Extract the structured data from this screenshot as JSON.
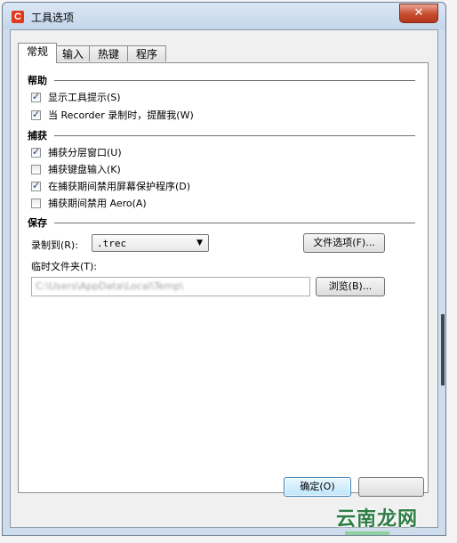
{
  "window": {
    "title": "工具选项",
    "app_icon": "C",
    "close_glyph": "✕"
  },
  "tabs": [
    {
      "label": "常规",
      "active": true
    },
    {
      "label": "输入",
      "active": false
    },
    {
      "label": "热键",
      "active": false
    },
    {
      "label": "程序",
      "active": false
    }
  ],
  "help_group": {
    "title": "帮助",
    "items": [
      {
        "label": "显示工具提示(S)",
        "checked": true
      },
      {
        "label": "当 Recorder 录制时，提醒我(W)",
        "checked": true
      }
    ]
  },
  "capture_group": {
    "title": "捕获",
    "items": [
      {
        "label": "捕获分层窗口(U)",
        "checked": true
      },
      {
        "label": "捕获键盘输入(K)",
        "checked": false
      },
      {
        "label": "在捕获期间禁用屏幕保护程序(D)",
        "checked": true
      },
      {
        "label": "捕获期间禁用 Aero(A)",
        "checked": false
      }
    ]
  },
  "save_group": {
    "title": "保存",
    "record_to_label": "录制到(R):",
    "record_to_value": ".trec",
    "file_options_button": "文件选项(F)...",
    "temp_folder_label": "临时文件夹(T):",
    "temp_folder_value": "C:\\Users\\AppData\\Local\\Temp\\",
    "browse_button": "浏览(B)..."
  },
  "footer": {
    "ok_button": "确定(O)"
  },
  "watermark": "云南龙网",
  "icons": {
    "check": "check-icon",
    "dropdown": "chevron-down-icon",
    "close": "close-icon"
  }
}
